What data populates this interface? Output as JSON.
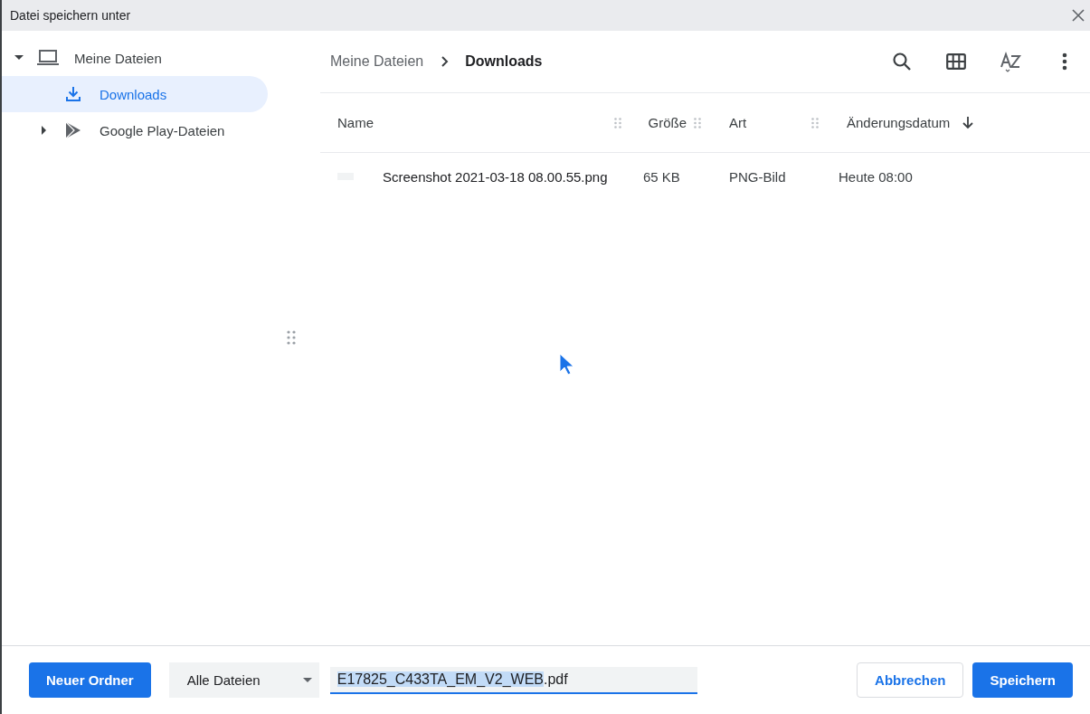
{
  "window": {
    "title": "Datei speichern unter"
  },
  "sidebar": {
    "items": [
      {
        "label": "Meine Dateien",
        "expandable": true,
        "expanded": true,
        "selected": false,
        "children": [
          {
            "label": "Downloads",
            "expandable": false,
            "expanded": false,
            "selected": true
          },
          {
            "label": "Google Play-Dateien",
            "expandable": true,
            "expanded": false,
            "selected": false
          }
        ]
      }
    ]
  },
  "breadcrumb": [
    {
      "label": "Meine Dateien",
      "current": false
    },
    {
      "label": "Downloads",
      "current": true
    }
  ],
  "table": {
    "columns": [
      {
        "label": "Name",
        "sorted": false
      },
      {
        "label": "Größe",
        "sorted": false
      },
      {
        "label": "Art",
        "sorted": false
      },
      {
        "label": "Änderungsdatum",
        "sorted": true
      }
    ],
    "rows": [
      {
        "name": "Screenshot 2021-03-18 08.00.55.png",
        "size": "65 KB",
        "type": "PNG-Bild",
        "modified": "Heute 08:00"
      }
    ]
  },
  "footer": {
    "new_folder_button": "Neuer Ordner",
    "file_type": "Alle Dateien",
    "filename": {
      "selected_text": "E17825_C433TA_EM_V2_WEB",
      "rest_text": ".pdf"
    },
    "cancel_button": "Abbrechen",
    "save_button": "Speichern"
  }
}
